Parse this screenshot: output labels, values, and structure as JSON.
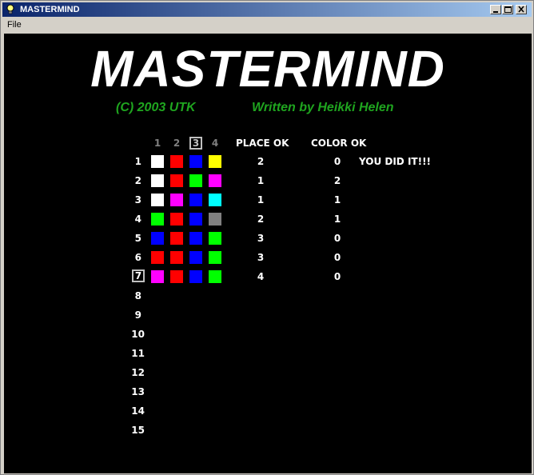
{
  "window": {
    "title": "MASTERMIND",
    "icon": "lightbulb-icon"
  },
  "menu": {
    "file": "File"
  },
  "header": {
    "title": "MASTERMIND",
    "copyright": "(C) 2003 UTK",
    "author": "Written by Heikki Helen"
  },
  "columns": [
    "1",
    "2",
    "3",
    "4"
  ],
  "selected_column": 3,
  "labels": {
    "place_ok": "PLACE OK",
    "color_ok": "COLOR OK"
  },
  "colors": {
    "white": "#ffffff",
    "red": "#ff0000",
    "blue": "#0000ff",
    "yellow": "#ffff00",
    "green": "#00ff00",
    "magenta": "#ff00ff",
    "cyan": "#00ffff",
    "gray": "#808080",
    "credit_green": "#1fa51f"
  },
  "rows": [
    {
      "label": "1",
      "pegs": [
        "white",
        "red",
        "blue",
        "yellow"
      ],
      "place_ok": "2",
      "color_ok": "0",
      "message": "YOU DID IT!!!"
    },
    {
      "label": "2",
      "pegs": [
        "white",
        "red",
        "green",
        "magenta"
      ],
      "place_ok": "1",
      "color_ok": "2",
      "message": ""
    },
    {
      "label": "3",
      "pegs": [
        "white",
        "magenta",
        "blue",
        "cyan"
      ],
      "place_ok": "1",
      "color_ok": "1",
      "message": ""
    },
    {
      "label": "4",
      "pegs": [
        "green",
        "red",
        "blue",
        "gray"
      ],
      "place_ok": "2",
      "color_ok": "1",
      "message": ""
    },
    {
      "label": "5",
      "pegs": [
        "blue",
        "red",
        "blue",
        "green"
      ],
      "place_ok": "3",
      "color_ok": "0",
      "message": ""
    },
    {
      "label": "6",
      "pegs": [
        "red",
        "red",
        "blue",
        "green"
      ],
      "place_ok": "3",
      "color_ok": "0",
      "message": ""
    },
    {
      "label": "7",
      "pegs": [
        "magenta",
        "red",
        "blue",
        "green"
      ],
      "place_ok": "4",
      "color_ok": "0",
      "message": ""
    },
    {
      "label": "8",
      "pegs": [],
      "place_ok": "",
      "color_ok": "",
      "message": ""
    },
    {
      "label": "9",
      "pegs": [],
      "place_ok": "",
      "color_ok": "",
      "message": ""
    },
    {
      "label": "10",
      "pegs": [],
      "place_ok": "",
      "color_ok": "",
      "message": ""
    },
    {
      "label": "11",
      "pegs": [],
      "place_ok": "",
      "color_ok": "",
      "message": ""
    },
    {
      "label": "12",
      "pegs": [],
      "place_ok": "",
      "color_ok": "",
      "message": ""
    },
    {
      "label": "13",
      "pegs": [],
      "place_ok": "",
      "color_ok": "",
      "message": ""
    },
    {
      "label": "14",
      "pegs": [],
      "place_ok": "",
      "color_ok": "",
      "message": ""
    },
    {
      "label": "15",
      "pegs": [],
      "place_ok": "",
      "color_ok": "",
      "message": ""
    }
  ],
  "selected_row": 7
}
